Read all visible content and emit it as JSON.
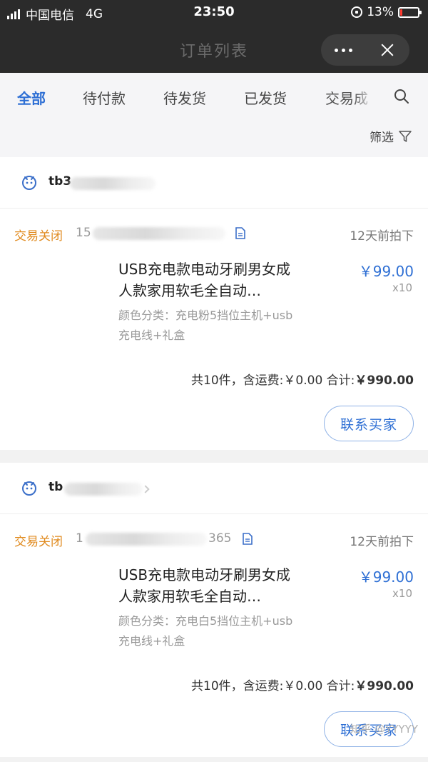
{
  "status_bar": {
    "carrier": "中国电信",
    "network": "4G",
    "time": "23:50",
    "battery": "13%",
    "battery_level": 0.13
  },
  "nav": {
    "title": "订单列表"
  },
  "tabs": [
    {
      "label": "全部",
      "active": true
    },
    {
      "label": "待付款"
    },
    {
      "label": "待发货"
    },
    {
      "label": "已发货"
    },
    {
      "label": "交易成"
    }
  ],
  "filter_label": "筛选",
  "orders": [
    {
      "shop": "tb3",
      "status": "交易关闭",
      "order_no": "15",
      "time_ago": "12天前拍下",
      "product_name": "USB充电款电动牙刷男女成人款家用软毛全自动…",
      "price": "￥99.00",
      "qty": "x10",
      "spec": "颜色分类：充电粉5挡位主机+usb充电线+礼盒",
      "summary_count": "共10件，含运费:￥0.00 合计:",
      "summary_total": "￥990.00",
      "contact_label": "联系买家"
    },
    {
      "shop": "tb",
      "status": "交易关闭",
      "order_no": "1",
      "order_no_tail": "365",
      "time_ago": "12天前拍下",
      "product_name": "USB充电款电动牙刷男女成人款家用软毛全自动…",
      "price": "￥99.00",
      "qty": "x10",
      "spec": "颜色分类：充电白5挡位主机+usb充电线+礼盒",
      "summary_count": "共10件，含运费:￥0.00 合计:",
      "summary_total": "￥990.00",
      "contact_label": "联系买家"
    }
  ],
  "watermark": "知乎 @YYYYY"
}
